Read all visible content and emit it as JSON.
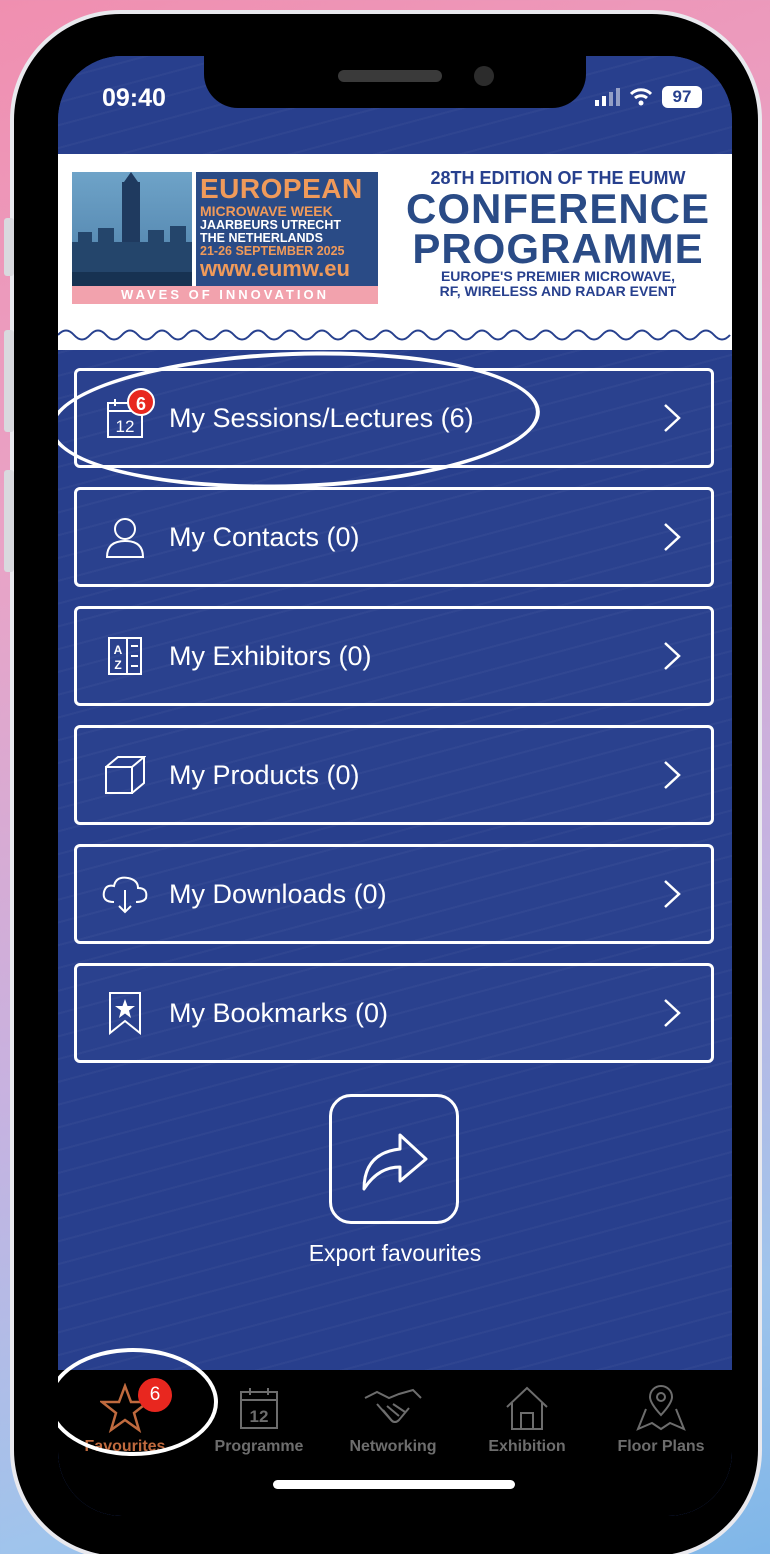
{
  "status": {
    "time": "09:40",
    "battery": "97"
  },
  "banner": {
    "logo": {
      "line1": "EUROPEAN",
      "line2": "MICROWAVE WEEK",
      "line3": "JAARBEURS UTRECHT",
      "line4": "THE NETHERLANDS",
      "line5": "21-26 SEPTEMBER 2025",
      "line6": "www.eumw.eu",
      "strip": "WAVES OF INNOVATION"
    },
    "edition": "28TH EDITION OF THE EUMW",
    "title1": "CONFERENCE",
    "title2": "PROGRAMME",
    "sub1": "EUROPE'S PREMIER MICROWAVE,",
    "sub2": "RF, WIRELESS AND RADAR EVENT"
  },
  "menu": [
    {
      "label": "My Sessions/Lectures (6)",
      "icon": "calendar-icon",
      "badge": "6"
    },
    {
      "label": "My Contacts (0)",
      "icon": "person-icon"
    },
    {
      "label": "My Exhibitors (0)",
      "icon": "az-list-icon"
    },
    {
      "label": "My Products (0)",
      "icon": "cube-icon"
    },
    {
      "label": "My Downloads (0)",
      "icon": "cloud-download-icon"
    },
    {
      "label": "My Bookmarks (0)",
      "icon": "bookmark-star-icon"
    }
  ],
  "export": {
    "label": "Export favourites"
  },
  "tabs": [
    {
      "label": "Favourites",
      "badge": "6",
      "active": true
    },
    {
      "label": "Programme"
    },
    {
      "label": "Networking"
    },
    {
      "label": "Exhibition"
    },
    {
      "label": "Floor Plans"
    }
  ],
  "calendar_day": "12",
  "colors": {
    "app_blue": "#283f8d",
    "accent_orange": "#c06a3e",
    "badge_red": "#e8271f"
  }
}
